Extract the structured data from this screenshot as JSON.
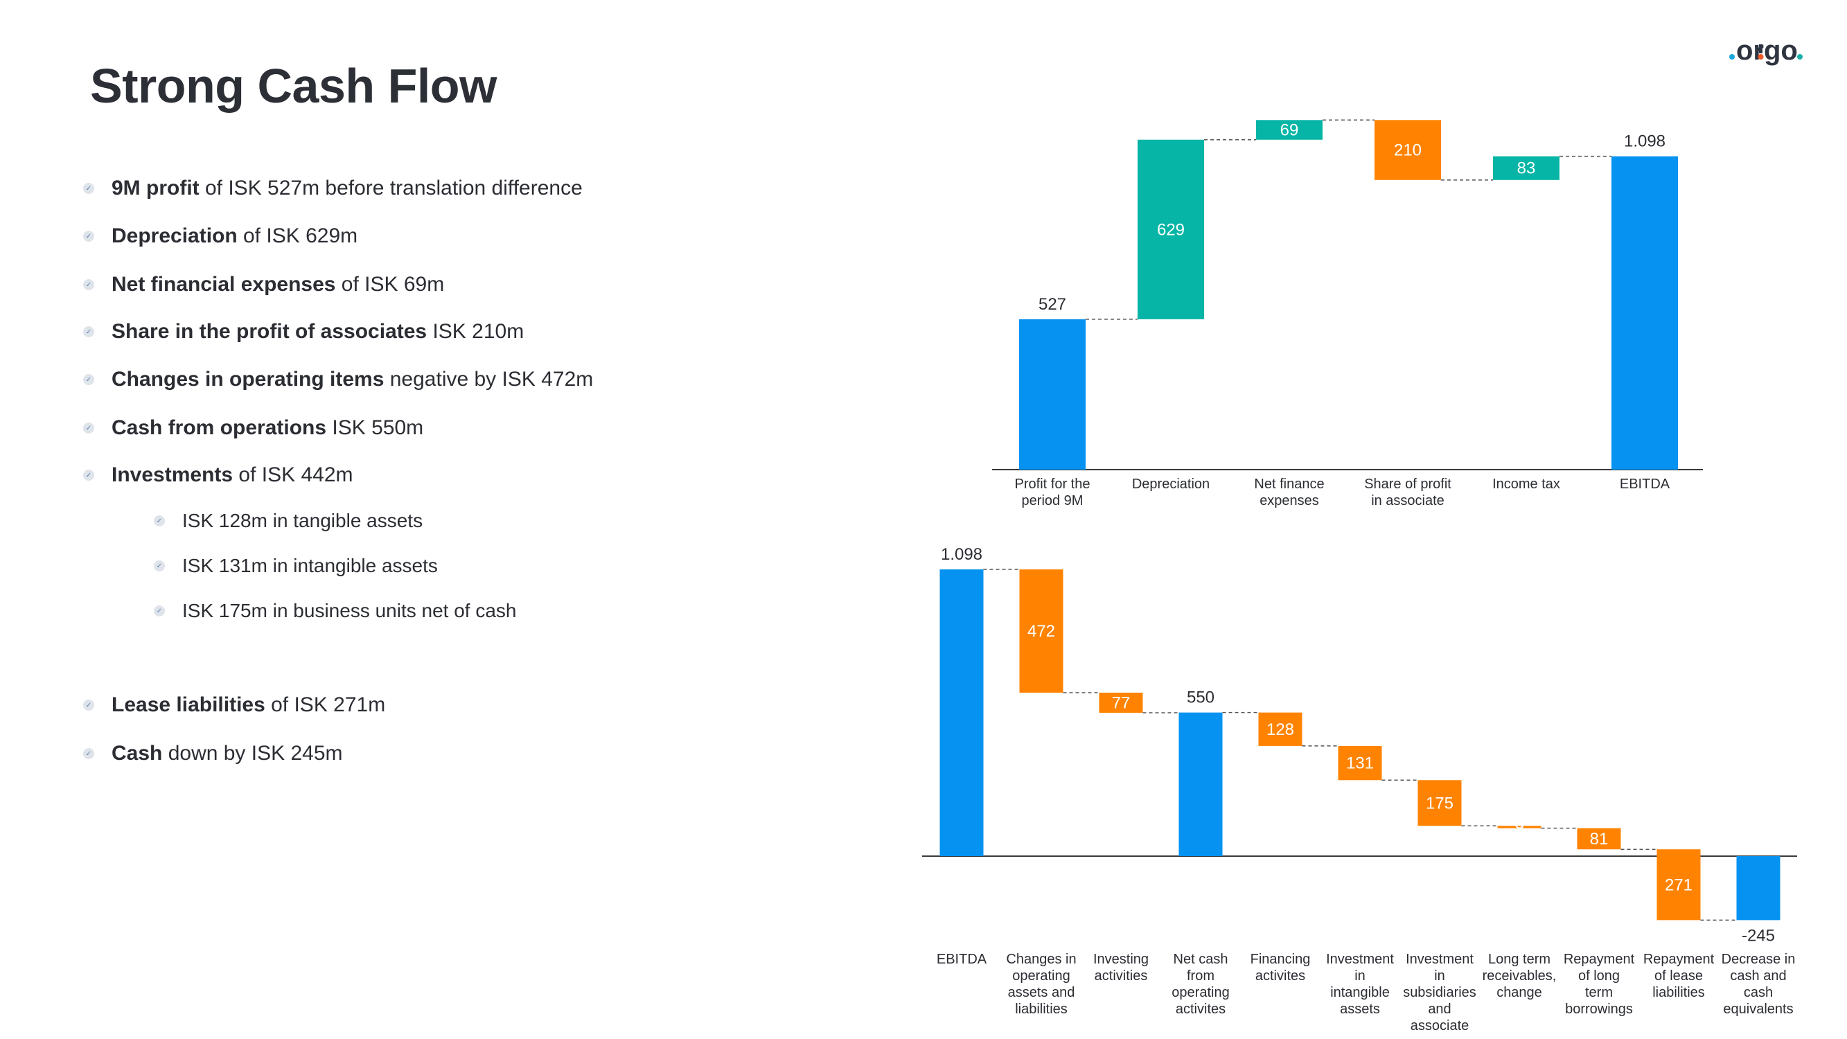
{
  "title": "Strong Cash Flow",
  "logo": {
    "text": ".origo.",
    "colors": [
      "#2f3540",
      "#1aa7e0",
      "#f05a28",
      "#1ab0a8"
    ]
  },
  "bullets": [
    {
      "bold": "9M profit",
      "rest": " of ISK 527m before translation difference",
      "level": 1
    },
    {
      "bold": "Depreciation",
      "rest": " of ISK 629m",
      "level": 1
    },
    {
      "bold": "Net financial expenses",
      "rest": " of ISK 69m",
      "level": 1
    },
    {
      "bold": "Share in the profit of associates",
      "rest": " ISK 210m",
      "level": 1
    },
    {
      "bold": "Changes in operating items",
      "rest": " negative by ISK 472m",
      "level": 1
    },
    {
      "bold": "Cash from operations",
      "rest": " ISK 550m",
      "level": 1
    },
    {
      "bold": "Investments",
      "rest": " of ISK 442m",
      "level": 1
    },
    {
      "bold": "",
      "rest": "ISK 128m in tangible assets",
      "level": 2
    },
    {
      "bold": "",
      "rest": "ISK 131m in intangible assets",
      "level": 2
    },
    {
      "bold": "",
      "rest": "ISK 175m in business units net of cash",
      "level": 2
    },
    {
      "bold": "Lease liabilities",
      "rest": " of ISK 271m",
      "level": 1
    },
    {
      "bold": "Cash",
      "rest": " down by ISK 245m",
      "level": 1
    }
  ],
  "colors": {
    "total": "#0592f0",
    "increase": "#06b5a5",
    "decrease": "#ff8300",
    "text": "#2b2d33"
  },
  "chart_data": [
    {
      "type": "waterfall",
      "steps": [
        {
          "category": [
            "Profit for the",
            "period 9M"
          ],
          "kind": "total",
          "value": 527,
          "label": "527"
        },
        {
          "category": [
            "Depreciation"
          ],
          "kind": "increase",
          "value": 629,
          "label": "629"
        },
        {
          "category": [
            "Net finance",
            "expenses"
          ],
          "kind": "increase",
          "value": 69,
          "label": "69"
        },
        {
          "category": [
            "Share of profit",
            "in associate"
          ],
          "kind": "decrease",
          "value": -210,
          "label": "210"
        },
        {
          "category": [
            "Income tax"
          ],
          "kind": "increase",
          "value": 83,
          "label": "83"
        },
        {
          "category": [
            "EBITDA"
          ],
          "kind": "total",
          "value": 1098,
          "label": "1.098"
        }
      ]
    },
    {
      "type": "waterfall",
      "steps": [
        {
          "category": [
            "EBITDA"
          ],
          "kind": "total",
          "value": 1098,
          "label": "1.098"
        },
        {
          "category": [
            "Changes in",
            "operating",
            "assets and",
            "liabilities"
          ],
          "kind": "decrease",
          "value": -472,
          "label": "472"
        },
        {
          "category": [
            "Investing",
            "activities"
          ],
          "kind": "decrease",
          "value": -77,
          "label": "77"
        },
        {
          "category": [
            "Net cash",
            "from",
            "operating",
            "activites"
          ],
          "kind": "total",
          "value": 550,
          "label": "550"
        },
        {
          "category": [
            "Financing",
            "activites"
          ],
          "kind": "decrease",
          "value": -128,
          "label": "128"
        },
        {
          "category": [
            "Investment",
            "in",
            "intangible",
            "assets"
          ],
          "kind": "decrease",
          "value": -131,
          "label": "131"
        },
        {
          "category": [
            "Investment",
            "in",
            "subsidiaries",
            "and",
            "associate"
          ],
          "kind": "decrease",
          "value": -175,
          "label": "175"
        },
        {
          "category": [
            "Long term",
            "receivables,",
            "change"
          ],
          "kind": "decrease",
          "value": -9,
          "label": "9"
        },
        {
          "category": [
            "Repayment",
            "of long",
            "term",
            "borrowings"
          ],
          "kind": "decrease",
          "value": -81,
          "label": "81"
        },
        {
          "category": [
            "Repayment",
            "of lease",
            "liabilities"
          ],
          "kind": "decrease",
          "value": -271,
          "label": "271"
        },
        {
          "category": [
            "Decrease in",
            "cash and",
            "cash",
            "equivalents"
          ],
          "kind": "total",
          "value": -245,
          "label": "-245"
        }
      ]
    }
  ]
}
